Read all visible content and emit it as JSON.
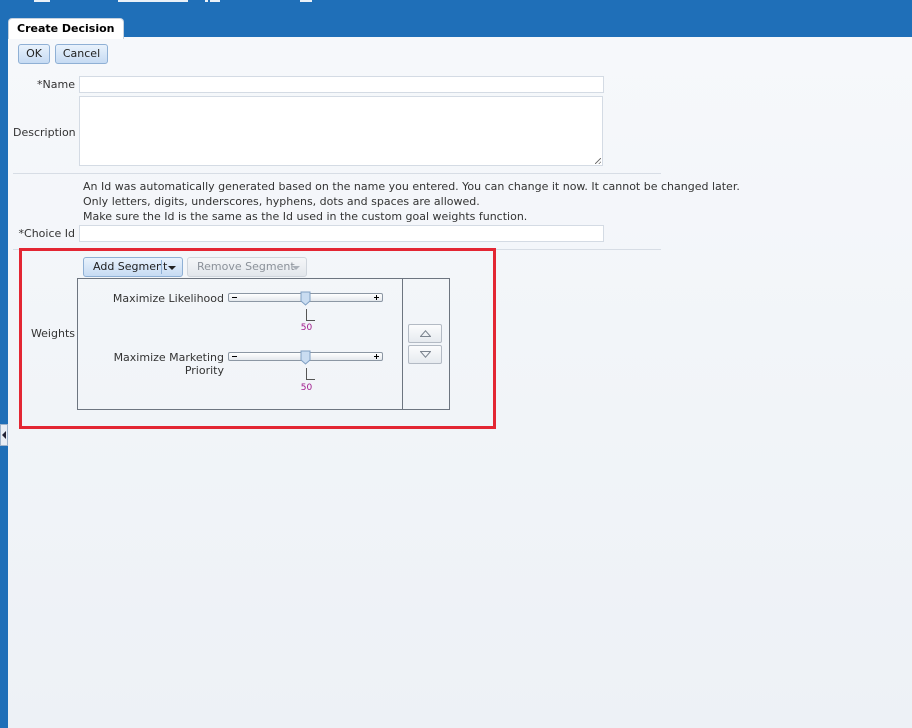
{
  "tab": {
    "title": "Create Decision"
  },
  "toolbar": {
    "ok_label": "OK",
    "cancel_label": "Cancel"
  },
  "form": {
    "name_label": "Name",
    "name_value": "",
    "description_label": "Description",
    "description_value": "",
    "required_marker": "*",
    "help_lines": [
      "An Id was automatically generated based on the name you entered. You can change it now. It cannot be changed later.",
      "Only letters, digits, underscores, hyphens, dots and spaces are allowed.",
      "Make sure the Id is the same as the Id used in the custom goal weights function."
    ],
    "choice_id_label": "Choice Id",
    "choice_id_value": ""
  },
  "weights": {
    "label": "Weights",
    "add_segment_label": "Add Segment",
    "remove_segment_label": "Remove Segment",
    "remove_segment_enabled": false,
    "sliders": [
      {
        "label": "Maximize Likelihood",
        "value": 50,
        "min": 0,
        "max": 100
      },
      {
        "label_line1": "Maximize Marketing",
        "label_line2": "Priority",
        "value": 50,
        "min": 0,
        "max": 100
      }
    ]
  },
  "colors": {
    "header_blue": "#1f6fb8",
    "highlight_red": "#e32633",
    "value_magenta": "#a0198c"
  },
  "icons": {
    "move_up": "triangle-up-icon",
    "move_down": "triangle-down-icon",
    "dropdown": "caret-down-icon",
    "collapse": "chevron-left-icon"
  }
}
